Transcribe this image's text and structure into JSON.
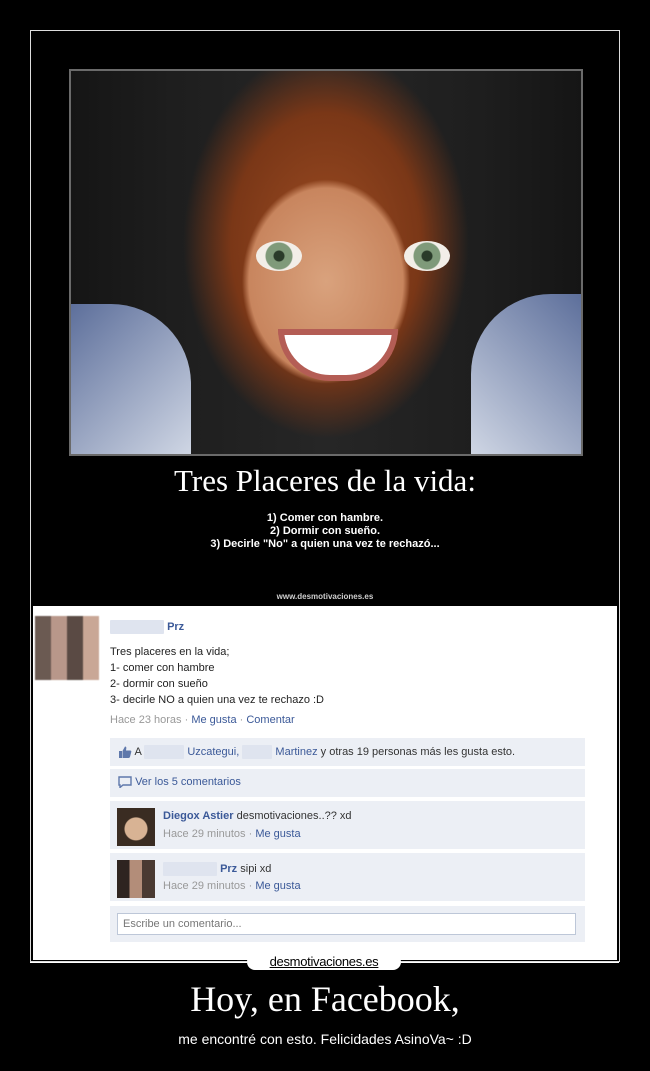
{
  "poster": {
    "title": "Tres Placeres de la vida:",
    "line1": "1) Comer con hambre.",
    "line2": "2) Dormir con sueño.",
    "line3": "3) Decirle \"No\" a quien una vez te rechazó...",
    "site": "www.desmotivaciones.es"
  },
  "post": {
    "author": "Prz",
    "body": "Tres placeres en la vida;\n1- comer con hambre\n2- dormir con sueño\n3- decirle NO a quien una vez te rechazo :D",
    "time": "Hace 23 horas",
    "like_action": "Me gusta",
    "comment_action": "Comentar",
    "likes_prefix": "A",
    "likes_name1": "Uzcategui,",
    "likes_name2": "Martinez",
    "likes_suffix": "y otras 19 personas más les gusta esto.",
    "view_comments": "Ver los 5 comentarios",
    "comments": [
      {
        "author": "Diegox Astier",
        "text": "desmotivaciones..?? xd",
        "time": "Hace 29 minutos",
        "like": "Me gusta"
      },
      {
        "author": "Prz",
        "text": "sipi xd",
        "time": "Hace 29 minutos",
        "like": "Me gusta"
      }
    ],
    "write_placeholder": "Escribe un comentario..."
  },
  "watermark": "desmotivaciones.es",
  "headline": "Hoy, en Facebook,",
  "subline": "me encontré con esto. Felicidades AsinoVa~ :D"
}
